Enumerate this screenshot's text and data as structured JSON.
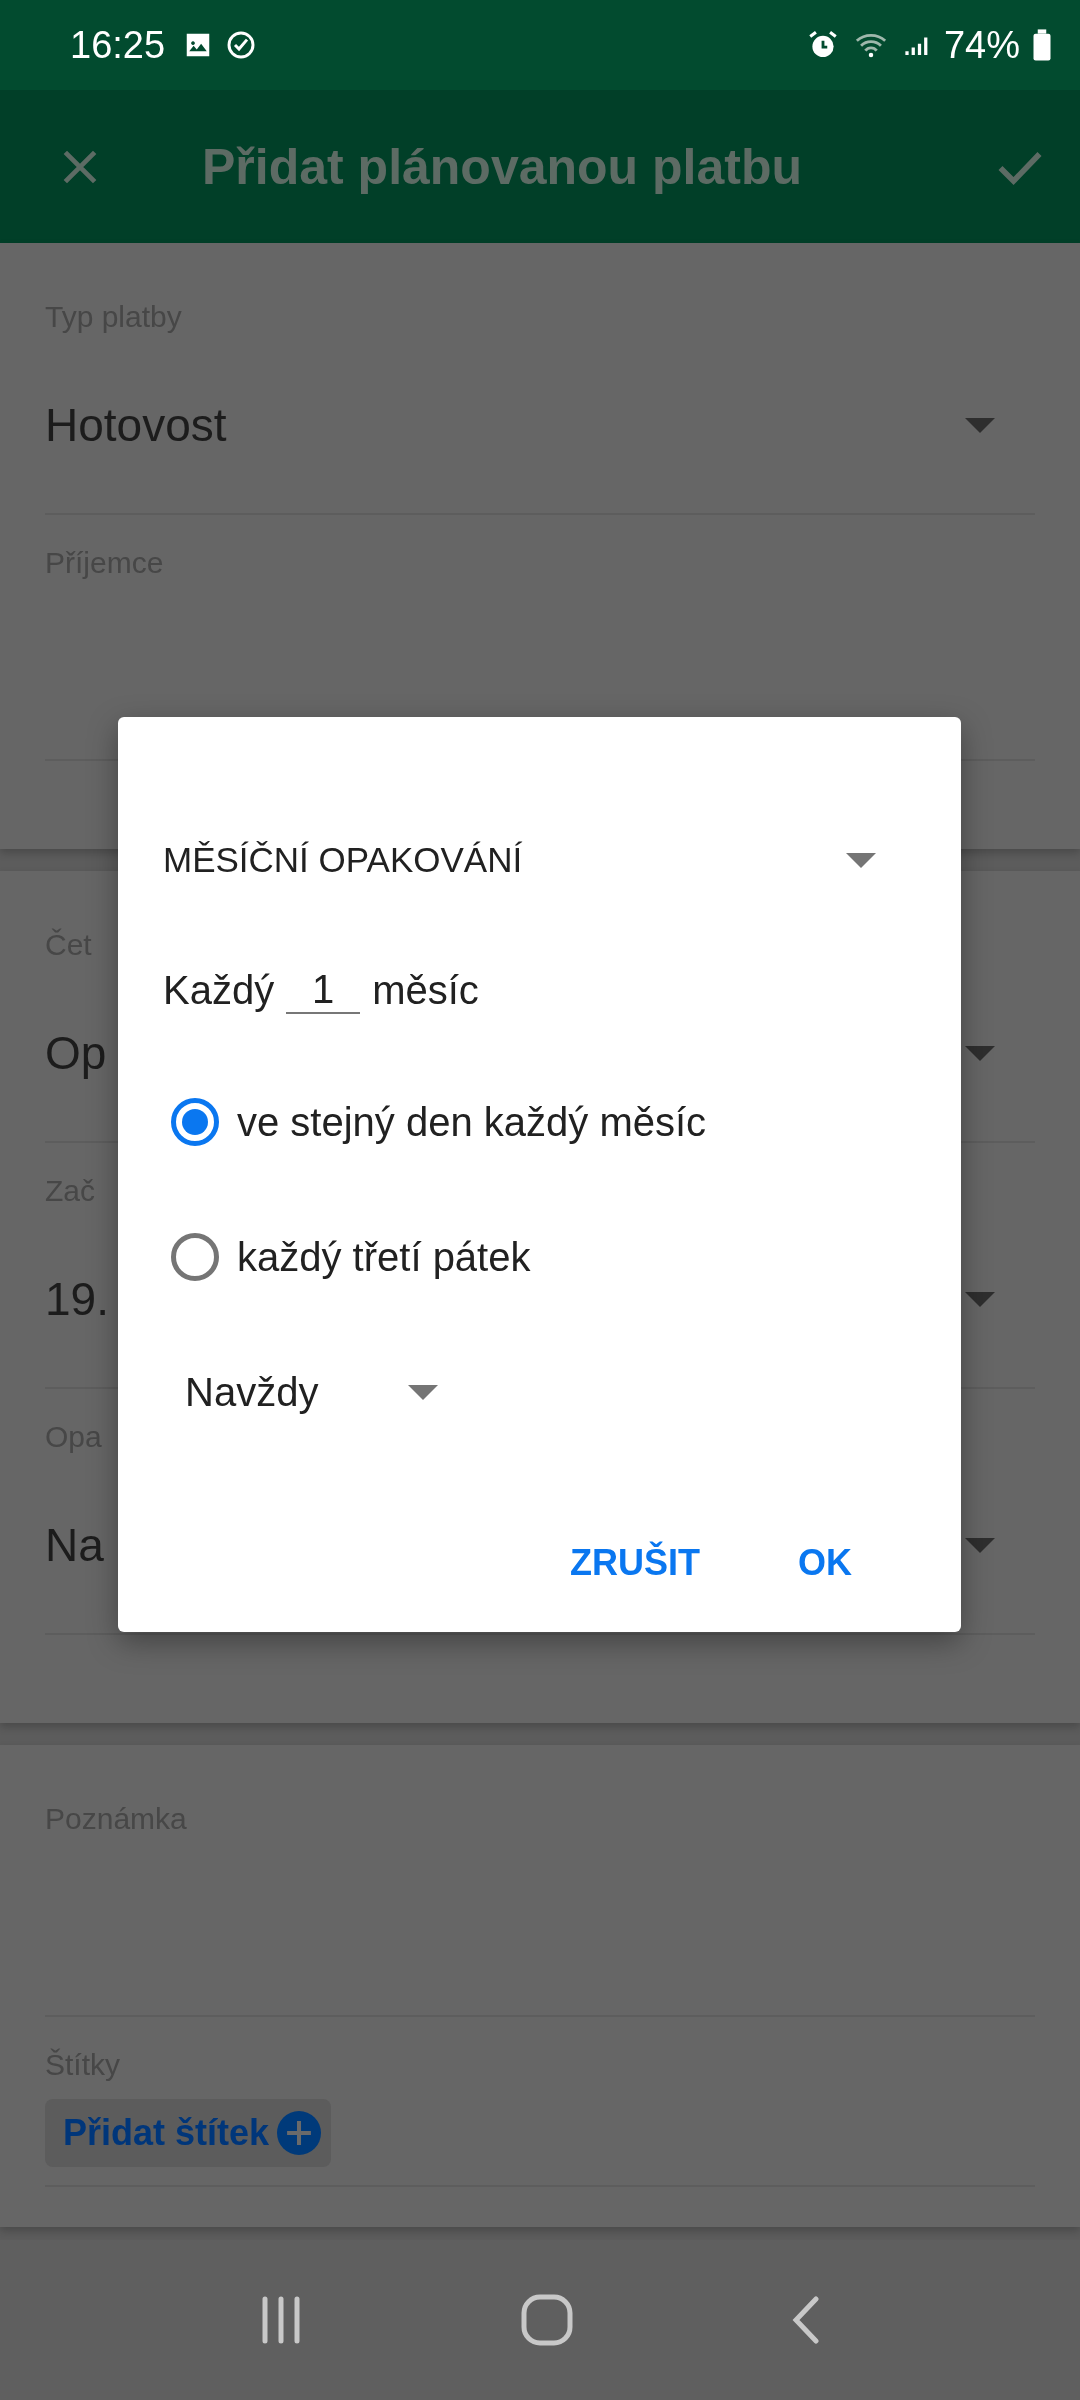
{
  "status_bar": {
    "time": "16:25",
    "battery": "74%"
  },
  "app_bar": {
    "title": "Přidat plánovanou platbu"
  },
  "sections": [
    {
      "fields": [
        {
          "kind": "dropdown",
          "label": "Typ platby",
          "value": "Hotovost"
        },
        {
          "kind": "text",
          "label": "Příjemce"
        }
      ]
    },
    {
      "fields": [
        {
          "kind": "dropdown",
          "label": "Čet",
          "value": "Op"
        },
        {
          "kind": "dropdown",
          "label": "Zač",
          "value": "19."
        },
        {
          "kind": "dropdown",
          "label": "Opa",
          "value": "Na"
        }
      ]
    },
    {
      "fields": [
        {
          "kind": "text",
          "label": "Poznámka"
        },
        {
          "kind": "tags",
          "label": "Štítky",
          "button": "Přidat štítek"
        }
      ]
    }
  ],
  "dialog": {
    "type": "MĚSÍČNÍ OPAKOVÁNÍ",
    "every_prefix": "Každý",
    "every_value": "1",
    "every_suffix": "měsíc",
    "options": [
      {
        "label": "ve stejný den každý měsíc",
        "selected": true
      },
      {
        "label": "každý třetí pátek",
        "selected": false
      }
    ],
    "end": "Navždy",
    "buttons": [
      "ZRUŠIT",
      "OK"
    ]
  }
}
